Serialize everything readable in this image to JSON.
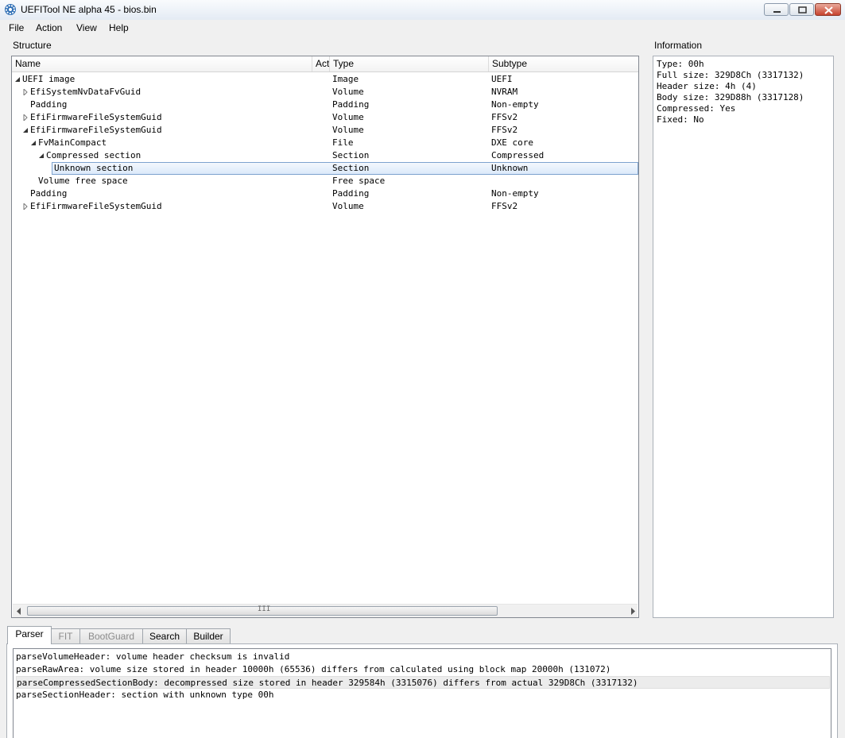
{
  "window": {
    "title": "UEFITool NE alpha 45 - bios.bin"
  },
  "menu": [
    "File",
    "Action",
    "View",
    "Help"
  ],
  "structure": {
    "label": "Structure",
    "columns": [
      "Name",
      "Action",
      "Type",
      "Subtype"
    ],
    "column_headers_visible": [
      "Name",
      "Act",
      "Type",
      "Subtype"
    ],
    "rows": [
      {
        "name": "UEFI image",
        "type": "Image",
        "subtype": "UEFI",
        "expander": "expanded",
        "level": 0
      },
      {
        "name": "EfiSystemNvDataFvGuid",
        "type": "Volume",
        "subtype": "NVRAM",
        "expander": "collapsed",
        "level": 1
      },
      {
        "name": "Padding",
        "type": "Padding",
        "subtype": "Non-empty",
        "expander": "none",
        "level": 1
      },
      {
        "name": "EfiFirmwareFileSystemGuid",
        "type": "Volume",
        "subtype": "FFSv2",
        "expander": "collapsed",
        "level": 1
      },
      {
        "name": "EfiFirmwareFileSystemGuid",
        "type": "Volume",
        "subtype": "FFSv2",
        "expander": "expanded",
        "level": 1
      },
      {
        "name": "FvMainCompact",
        "type": "File",
        "subtype": "DXE core",
        "expander": "expanded",
        "level": 2
      },
      {
        "name": "Compressed section",
        "type": "Section",
        "subtype": "Compressed",
        "expander": "expanded",
        "level": 3
      },
      {
        "name": "Unknown section",
        "type": "Section",
        "subtype": "Unknown",
        "expander": "none",
        "level": 4,
        "selected": true
      },
      {
        "name": "Volume free space",
        "type": "Free space",
        "subtype": "",
        "expander": "none",
        "level": 2
      },
      {
        "name": "Padding",
        "type": "Padding",
        "subtype": "Non-empty",
        "expander": "none",
        "level": 1
      },
      {
        "name": "EfiFirmwareFileSystemGuid",
        "type": "Volume",
        "subtype": "FFSv2",
        "expander": "collapsed",
        "level": 1
      }
    ],
    "scrollbar_grip": "III"
  },
  "information": {
    "label": "Information",
    "lines": [
      "Type: 00h",
      "Full size: 329D8Ch (3317132)",
      "Header size: 4h (4)",
      "Body size: 329D88h (3317128)",
      "Compressed: Yes",
      "Fixed: No"
    ]
  },
  "tabs": [
    {
      "label": "Parser",
      "active": true,
      "enabled": true
    },
    {
      "label": "FIT",
      "active": false,
      "enabled": false
    },
    {
      "label": "BootGuard",
      "active": false,
      "enabled": false
    },
    {
      "label": "Search",
      "active": false,
      "enabled": true
    },
    {
      "label": "Builder",
      "active": false,
      "enabled": true
    }
  ],
  "messages": [
    "parseVolumeHeader: volume header checksum is invalid",
    "parseRawArea: volume size stored in header 10000h (65536) differs from calculated using block map 20000h (131072)",
    "parseCompressedSectionBody: decompressed size stored in header 329584h (3315076) differs from actual 329D8Ch (3317132)",
    "parseSectionHeader: section with unknown type 00h"
  ],
  "highlighted_message_index": 2
}
